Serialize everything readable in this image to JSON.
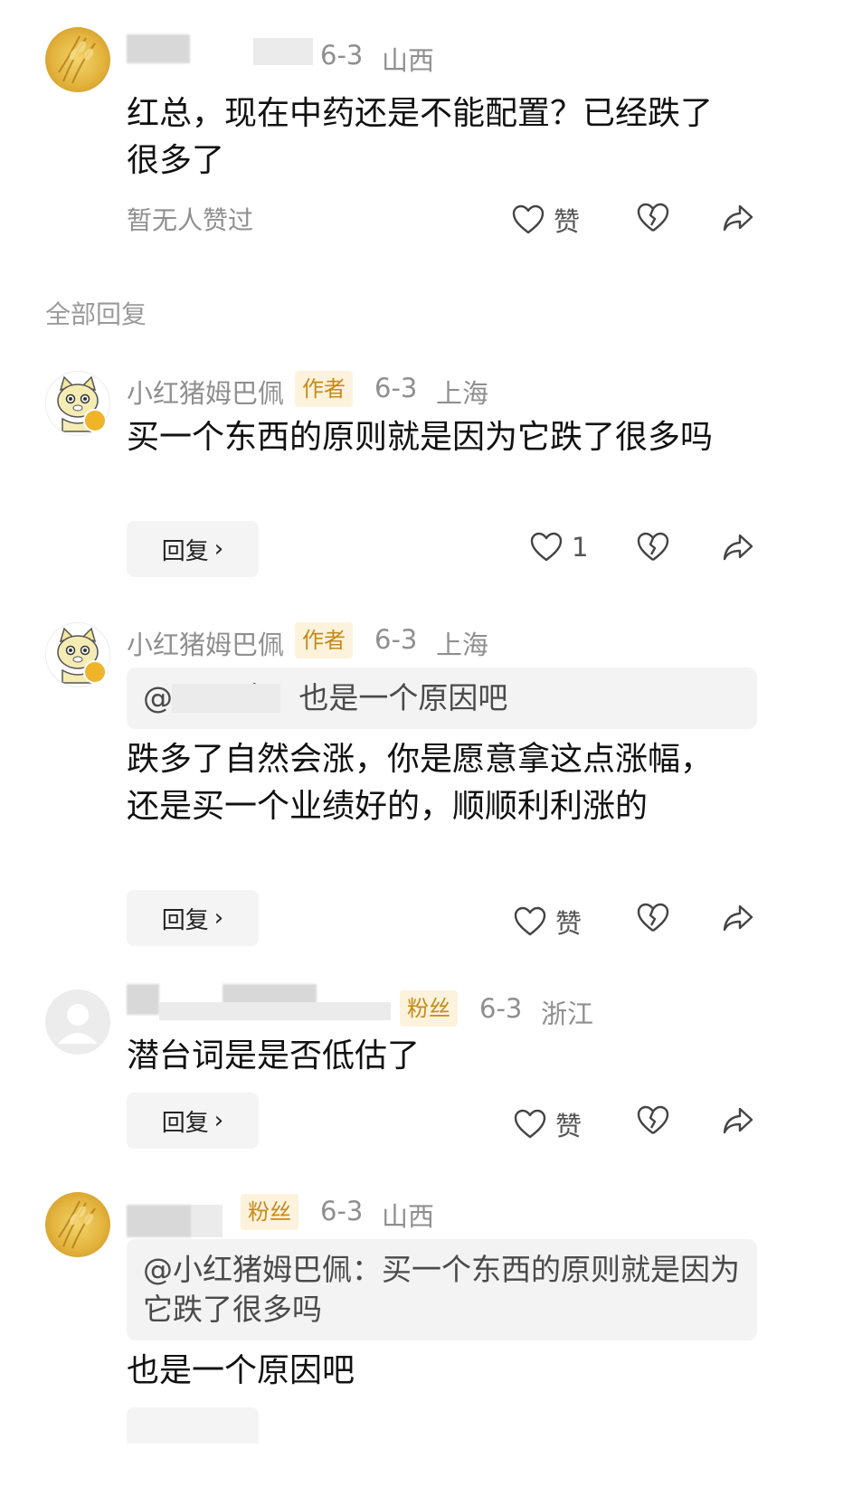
{
  "top_comment": {
    "date": "6-3",
    "location": "山西",
    "text": "红总，现在中药还是不能配置？已经跌了很多了",
    "no_likes": "暂无人赞过",
    "like_label": "赞"
  },
  "section_label": "全部回复",
  "replies": [
    {
      "name": "小红猪姆巴佩",
      "tag": "作者",
      "date": "6-3",
      "location": "上海",
      "text": "买一个东西的原则就是因为它跌了很多吗",
      "reply_label": "回复",
      "like_label": "1"
    },
    {
      "name": "小红猪姆巴佩",
      "tag": "作者",
      "date": "6-3",
      "location": "上海",
      "quote": "@       金：也是一个原因吧",
      "text": "跌多了自然会涨，你是愿意拿这点涨幅，还是买一个业绩好的，顺顺利利涨的",
      "reply_label": "回复",
      "like_label": "赞"
    },
    {
      "name": "",
      "tag": "粉丝",
      "date": "6-3",
      "location": "浙江",
      "text": "潜台词是是否低估了",
      "reply_label": "回复",
      "like_label": "赞"
    },
    {
      "name": "",
      "tag": "粉丝",
      "date": "6-3",
      "location": "山西",
      "quote": "@小红猪姆巴佩：买一个东西的原则就是因为它跌了很多吗",
      "text": "也是一个原因吧"
    }
  ],
  "icons": {
    "like": "heart-outline-icon",
    "dislike": "broken-heart-icon",
    "share": "share-arrow-icon",
    "chevron": "chevron-right-icon"
  },
  "colors": {
    "tag_text": "#c58a1a",
    "tag_bg": "#fdf2dc",
    "meta_gray": "#8f8f8f"
  }
}
